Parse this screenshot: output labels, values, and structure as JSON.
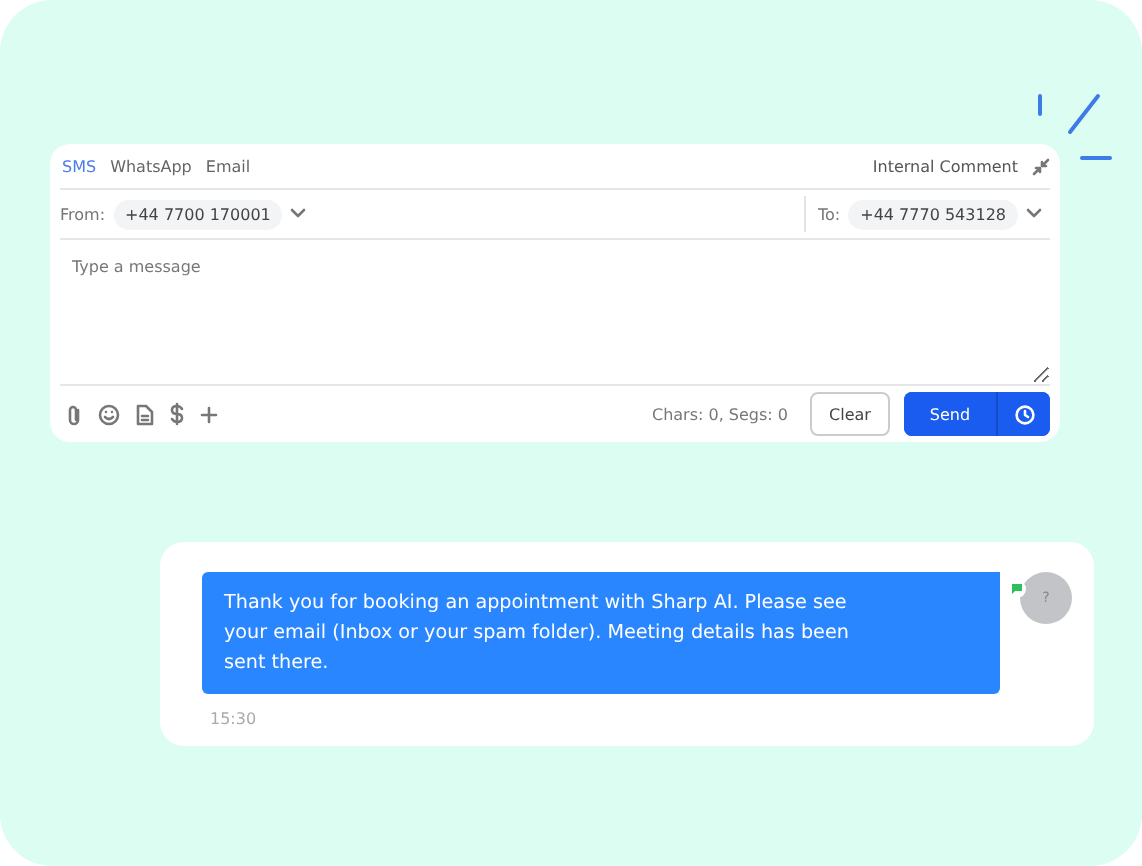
{
  "composer": {
    "tabs": [
      {
        "label": "SMS",
        "selected": true
      },
      {
        "label": "WhatsApp",
        "selected": false
      },
      {
        "label": "Email",
        "selected": false
      }
    ],
    "internal_comment": "Internal Comment",
    "from": {
      "label": "From:",
      "value": "+44 7700 170001"
    },
    "to": {
      "label": "To:",
      "value": "+44 7770 543128"
    },
    "message": {
      "placeholder": "Type a message"
    },
    "counter": "Chars: 0, Segs: 0",
    "clear_button": "Clear",
    "send_button": "Send"
  },
  "conversation": {
    "message": {
      "text": "Thank you for booking an appointment with Sharp AI. Please see your email (Inbox or your spam folder). Meeting details has been sent there.",
      "time": "15:30",
      "avatar": "?"
    }
  }
}
